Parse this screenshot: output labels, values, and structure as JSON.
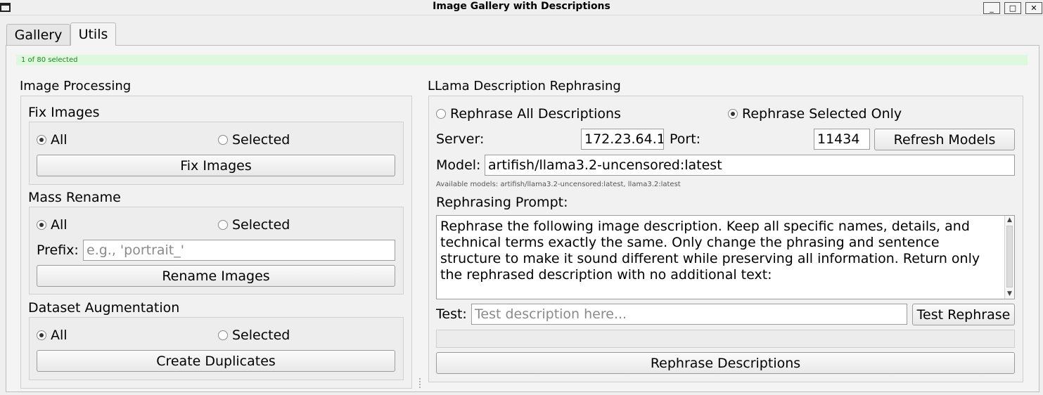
{
  "window": {
    "title": "Image Gallery with Descriptions",
    "minimize_label": "_",
    "maximize_label": "□",
    "close_label": "✕"
  },
  "tabs": [
    {
      "label": "Gallery",
      "active": false
    },
    {
      "label": "Utils",
      "active": true
    }
  ],
  "status": {
    "text": "1 of 80 selected",
    "color": "#ddf8dd"
  },
  "image_processing": {
    "title": "Image Processing",
    "fix_images": {
      "title": "Fix Images",
      "radio_all": "All",
      "radio_selected": "Selected",
      "selected_value": "All",
      "button": "Fix Images"
    },
    "mass_rename": {
      "title": "Mass Rename",
      "radio_all": "All",
      "radio_selected": "Selected",
      "selected_value": "All",
      "prefix_label": "Prefix:",
      "prefix_value": "",
      "prefix_placeholder": "e.g., 'portrait_'",
      "button": "Rename Images"
    },
    "dataset_augmentation": {
      "title": "Dataset Augmentation",
      "radio_all": "All",
      "radio_selected": "Selected",
      "selected_value": "All",
      "button": "Create Duplicates"
    }
  },
  "llama": {
    "title": "LLama Description Rephrasing",
    "radio_all": "Rephrase All Descriptions",
    "radio_selected": "Rephrase Selected Only",
    "selected_value": "Rephrase Selected Only",
    "server_label": "Server:",
    "server_value": "172.23.64.1",
    "port_label": "Port:",
    "port_value": "11434",
    "refresh_button": "Refresh Models",
    "model_label": "Model:",
    "model_value": "artifish/llama3.2-uncensored:latest",
    "available_models": "Available models: artifish/llama3.2-uncensored:latest, llama3.2:latest",
    "prompt_label": "Rephrasing Prompt:",
    "prompt_lines": [
      "Rephrase the following image description. Keep all specific names, details, and",
      "technical terms exactly the same. Only change the phrasing and sentence",
      "structure to make it sound different while preserving all information. Return only",
      "the rephrased description with no additional text:"
    ],
    "test_label": "Test:",
    "test_value": "",
    "test_placeholder": "Test description here...",
    "test_button": "Test Rephrase",
    "progress": 0,
    "rephrase_button": "Rephrase Descriptions"
  }
}
